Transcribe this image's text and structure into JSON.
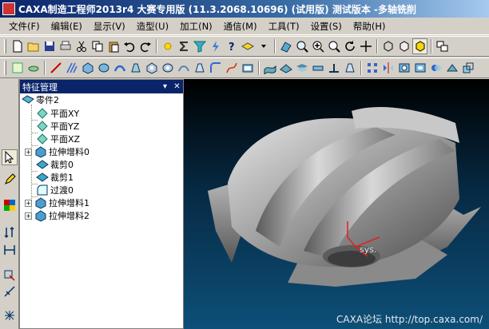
{
  "window": {
    "title": "CAXA制造工程师2013r4 大赛专用版 (11.3.2068.10696) (试用版) 测试版本 -多轴铣削"
  },
  "menu": [
    "文件(F)",
    "编辑(E)",
    "显示(V)",
    "造型(U)",
    "加工(N)",
    "通信(M)",
    "工具(T)",
    "设置(S)",
    "帮助(H)"
  ],
  "panel": {
    "title": "特征管理",
    "pin_symbol": "▾",
    "close_symbol": "✕"
  },
  "tree": {
    "root": "零件2",
    "plane_xy": "平面XY",
    "plane_yz": "平面YZ",
    "plane_xz": "平面XZ",
    "extrude0": "拉伸增料0",
    "trim0": "裁剪0",
    "trim1": "裁剪1",
    "fillet0": "过渡0",
    "extrude1": "拉伸增料1",
    "extrude2": "拉伸增料2",
    "expand_symbol": "+"
  },
  "viewport": {
    "axis_label": "sys.",
    "watermark": "CAXA论坛 http://top.caxa.com/"
  },
  "colors": {
    "title_start": "#0a246a",
    "title_end": "#a6caf0",
    "chrome": "#d4d0c8",
    "viewport_top": "#000000",
    "viewport_bottom": "#0d4f78"
  }
}
